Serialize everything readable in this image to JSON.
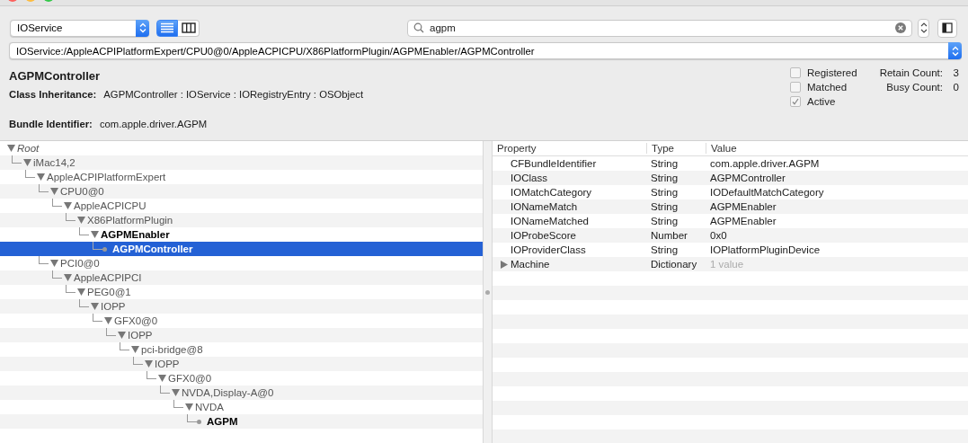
{
  "toolbar": {
    "plane": "IOService",
    "view_modes": [
      {
        "kind": "list",
        "selected": true
      },
      {
        "kind": "columns",
        "selected": false
      }
    ],
    "search": {
      "value": "agpm"
    }
  },
  "path": "IOService:/AppleACPIPlatformExpert/CPU0@0/AppleACPICPU/X86PlatformPlugin/AGPMEnabler/AGPMController",
  "details": {
    "title": "AGPMController",
    "class_label": "Class Inheritance:",
    "class_value": "AGPMController : IOService : IORegistryEntry : OSObject",
    "bundle_label": "Bundle Identifier:",
    "bundle_value": "com.apple.driver.AGPM",
    "flags": [
      {
        "label": "Registered",
        "checked": false
      },
      {
        "label": "Matched",
        "checked": false
      },
      {
        "label": "Active",
        "checked": true
      }
    ],
    "counts": [
      {
        "label": "Retain Count:",
        "value": "3"
      },
      {
        "label": "Busy Count:",
        "value": "0"
      }
    ]
  },
  "tree": [
    {
      "label": "Root",
      "italic": true,
      "matched": false,
      "selected": false,
      "children": [
        {
          "label": "iMac14,2",
          "matched": false,
          "selected": false,
          "children": [
            {
              "label": "AppleACPIPlatformExpert",
              "matched": false,
              "selected": false,
              "children": [
                {
                  "label": "CPU0@0",
                  "matched": false,
                  "selected": false,
                  "children": [
                    {
                      "label": "AppleACPICPU",
                      "matched": false,
                      "selected": false,
                      "children": [
                        {
                          "label": "X86PlatformPlugin",
                          "matched": false,
                          "selected": false,
                          "children": [
                            {
                              "label": "AGPMEnabler",
                              "matched": true,
                              "selected": false,
                              "children": [
                                {
                                  "label": "AGPMController",
                                  "matched": true,
                                  "selected": true
                                }
                              ]
                            }
                          ]
                        }
                      ]
                    }
                  ]
                },
                {
                  "label": "PCI0@0",
                  "matched": false,
                  "selected": false,
                  "children": [
                    {
                      "label": "AppleACPIPCI",
                      "matched": false,
                      "selected": false,
                      "children": [
                        {
                          "label": "PEG0@1",
                          "matched": false,
                          "selected": false,
                          "children": [
                            {
                              "label": "IOPP",
                              "matched": false,
                              "selected": false,
                              "children": [
                                {
                                  "label": "GFX0@0",
                                  "matched": false,
                                  "selected": false,
                                  "children": [
                                    {
                                      "label": "IOPP",
                                      "matched": false,
                                      "selected": false,
                                      "children": [
                                        {
                                          "label": "pci-bridge@8",
                                          "matched": false,
                                          "selected": false,
                                          "children": [
                                            {
                                              "label": "IOPP",
                                              "matched": false,
                                              "selected": false,
                                              "children": [
                                                {
                                                  "label": "GFX0@0",
                                                  "matched": false,
                                                  "selected": false,
                                                  "children": [
                                                    {
                                                      "label": "NVDA,Display-A@0",
                                                      "matched": false,
                                                      "selected": false,
                                                      "children": [
                                                        {
                                                          "label": "NVDA",
                                                          "matched": false,
                                                          "selected": false,
                                                          "children": [
                                                            {
                                                              "label": "AGPM",
                                                              "matched": true,
                                                              "selected": false
                                                            }
                                                          ]
                                                        }
                                                      ]
                                                    }
                                                  ]
                                                }
                                              ]
                                            }
                                          ]
                                        }
                                      ]
                                    }
                                  ]
                                }
                              ]
                            }
                          ]
                        }
                      ]
                    }
                  ]
                }
              ]
            }
          ]
        }
      ]
    }
  ],
  "properties": {
    "columns": [
      "Property",
      "Type",
      "Value"
    ],
    "rows": [
      {
        "kind": "leaf",
        "property": "CFBundleIdentifier",
        "type": "String",
        "value": "com.apple.driver.AGPM"
      },
      {
        "kind": "leaf",
        "property": "IOClass",
        "type": "String",
        "value": "AGPMController"
      },
      {
        "kind": "leaf",
        "property": "IOMatchCategory",
        "type": "String",
        "value": "IODefaultMatchCategory"
      },
      {
        "kind": "leaf",
        "property": "IONameMatch",
        "type": "String",
        "value": "AGPMEnabler"
      },
      {
        "kind": "leaf",
        "property": "IONameMatched",
        "type": "String",
        "value": "AGPMEnabler"
      },
      {
        "kind": "leaf",
        "property": "IOProbeScore",
        "type": "Number",
        "value": "0x0"
      },
      {
        "kind": "leaf",
        "property": "IOProviderClass",
        "type": "String",
        "value": "IOPlatformPluginDevice"
      },
      {
        "kind": "container",
        "expanded": false,
        "property": "Machine",
        "type": "Dictionary",
        "value": "1 value"
      }
    ]
  }
}
